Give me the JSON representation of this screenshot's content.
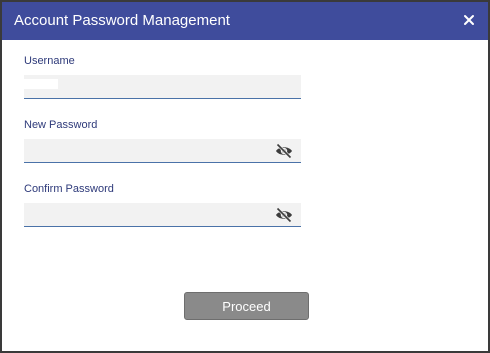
{
  "dialog": {
    "title": "Account Password Management",
    "close_icon": "close-icon",
    "accent_color": "#3f4c9c"
  },
  "form": {
    "username": {
      "label": "Username",
      "value": ""
    },
    "new_password": {
      "label": "New Password",
      "value": "",
      "toggle_icon": "eye-slash-icon"
    },
    "confirm_password": {
      "label": "Confirm Password",
      "value": "",
      "toggle_icon": "eye-slash-icon"
    }
  },
  "actions": {
    "proceed_label": "Proceed",
    "proceed_color": "#8a8a8a"
  }
}
